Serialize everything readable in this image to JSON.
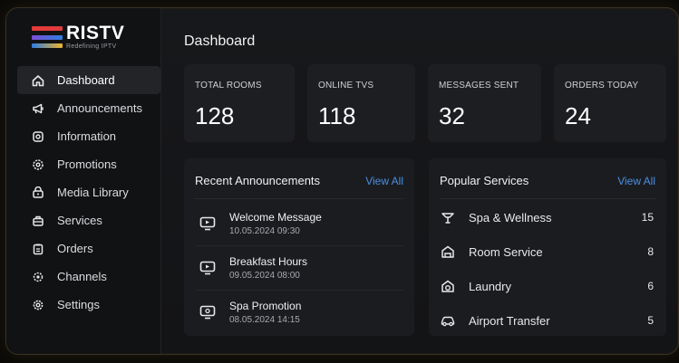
{
  "brand": {
    "name": "RISTV",
    "tagline": "Redefining IPTV",
    "colors": [
      "#e23b3b",
      "#7a4fd6",
      "#2f7de1",
      "#f0b429"
    ]
  },
  "sidebar": {
    "items": [
      {
        "label": "Dashboard",
        "icon": "home-icon",
        "active": true
      },
      {
        "label": "Announcements",
        "icon": "megaphone-icon",
        "active": false
      },
      {
        "label": "Information",
        "icon": "info-icon",
        "active": false
      },
      {
        "label": "Promotions",
        "icon": "tag-icon",
        "active": false
      },
      {
        "label": "Media Library",
        "icon": "media-icon",
        "active": false
      },
      {
        "label": "Services",
        "icon": "services-icon",
        "active": false
      },
      {
        "label": "Orders",
        "icon": "clipboard-icon",
        "active": false
      },
      {
        "label": "Channels",
        "icon": "channels-icon",
        "active": false
      },
      {
        "label": "Settings",
        "icon": "gear-icon",
        "active": false
      }
    ]
  },
  "header": {
    "title": "Dashboard"
  },
  "stats": [
    {
      "label": "TOTAL ROOMS",
      "value": "128"
    },
    {
      "label": "ONLINE TVS",
      "value": "118"
    },
    {
      "label": "MESSAGES SENT",
      "value": "32"
    },
    {
      "label": "ORDERS TODAY",
      "value": "24"
    }
  ],
  "announcements": {
    "title": "Recent Announcements",
    "view_all": "View All",
    "items": [
      {
        "title": "Welcome Message",
        "date": "10.05.2024 09:30"
      },
      {
        "title": "Breakfast Hours",
        "date": "09.05.2024 08:00"
      },
      {
        "title": "Spa Promotion",
        "date": "08.05.2024 14:15"
      }
    ]
  },
  "services": {
    "title": "Popular Services",
    "view_all": "View All",
    "items": [
      {
        "name": "Spa & Wellness",
        "count": "15",
        "icon": "spa-icon"
      },
      {
        "name": "Room Service",
        "count": "8",
        "icon": "room-service-icon"
      },
      {
        "name": "Laundry",
        "count": "6",
        "icon": "laundry-icon"
      },
      {
        "name": "Airport Transfer",
        "count": "5",
        "icon": "car-icon"
      }
    ]
  },
  "accent": "#4a90e2"
}
